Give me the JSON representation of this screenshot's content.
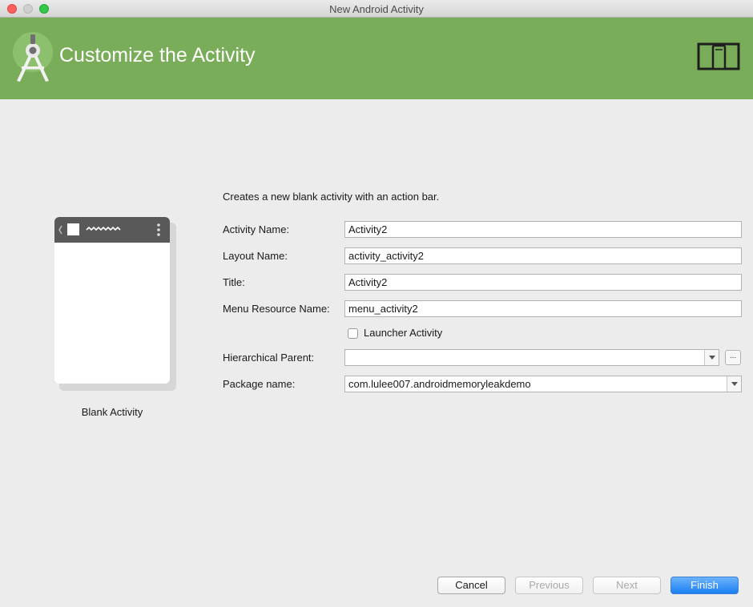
{
  "window": {
    "title": "New Android Activity"
  },
  "banner": {
    "title": "Customize the Activity",
    "color": "#7aad5a"
  },
  "template_preview": {
    "label": "Blank Activity"
  },
  "form": {
    "description": "Creates a new blank activity with an action bar.",
    "activity_name": {
      "label": "Activity Name:",
      "value": "Activity2"
    },
    "layout_name": {
      "label": "Layout Name:",
      "value": "activity_activity2"
    },
    "title": {
      "label": "Title:",
      "value": "Activity2"
    },
    "menu_resource_name": {
      "label": "Menu Resource Name:",
      "value": "menu_activity2"
    },
    "launcher_activity": {
      "label": "Launcher Activity",
      "checked": false
    },
    "hierarchical_parent": {
      "label": "Hierarchical Parent:",
      "value": "",
      "browse_label": "..."
    },
    "package_name": {
      "label": "Package name:",
      "value": "com.lulee007.androidmemoryleakdemo"
    }
  },
  "buttons": {
    "cancel": "Cancel",
    "previous": "Previous",
    "next": "Next",
    "finish": "Finish"
  },
  "icons": {
    "logo": "android-studio-icon",
    "form_factor": "devices-icon"
  }
}
